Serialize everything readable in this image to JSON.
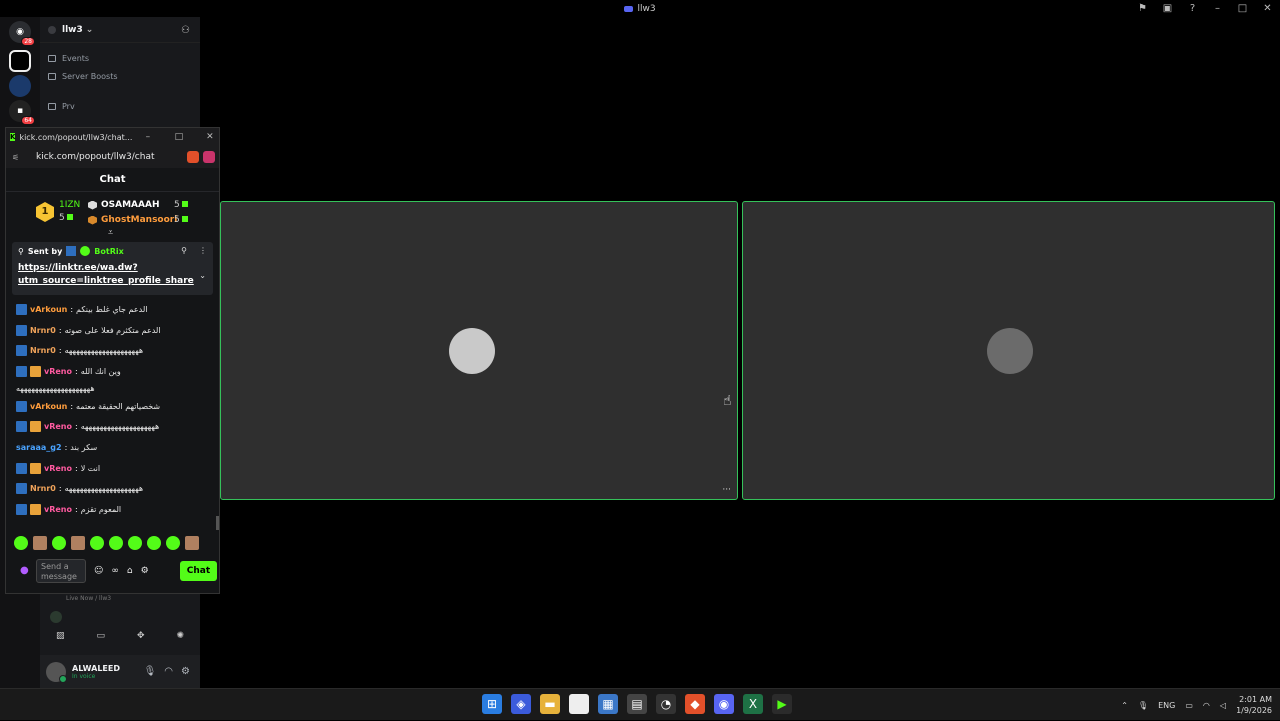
{
  "window": {
    "title": "llw3",
    "buttons": [
      "pin-icon",
      "inbox-icon",
      "help-icon"
    ]
  },
  "guilds": {
    "top_badge": "28",
    "mid_badge": "64",
    "srv_label": "llw3"
  },
  "server": {
    "name": "llw3",
    "channels": [
      {
        "label": "Events",
        "icon": "calendar-icon"
      },
      {
        "label": "Server Boosts",
        "icon": "boost-icon"
      },
      {
        "label": "Prv",
        "icon": "speaker-icon"
      }
    ],
    "voice_status": "Live Now / llw3"
  },
  "user": {
    "name": "ALWALEED",
    "status": "In voice"
  },
  "popout": {
    "title": "kick.com/popout/llw3/chat...",
    "url": "kick.com/popout/llw3/chat",
    "chat_title": "Chat",
    "leaderboard": {
      "first": {
        "rank": "1",
        "name": "1IZN",
        "count": "5"
      },
      "others": [
        {
          "name": "OSAMAAAH",
          "count": "5"
        },
        {
          "name": "GhostMansoori",
          "count": "5"
        }
      ]
    },
    "pinned": {
      "sent_by_label": "Sent by",
      "bot_name": "BotRix",
      "link_line1": "https://linktr.ee/wa.dw?",
      "link_line2": "utm_source=linktree_profile_share"
    },
    "messages": [
      {
        "user": "vArkoun",
        "color": "#ff9d3d",
        "text": "الدعم جاي غلط بينكم",
        "crown": false,
        "badge": true
      },
      {
        "user": "Nrnr0",
        "color": "#f0a35a",
        "text": "الدعم متكثرم فعلا على صوته",
        "crown": false,
        "badge": true
      },
      {
        "user": "Nrnr0",
        "color": "#f0a35a",
        "text": "ههههههههههههههههههههه",
        "crown": false,
        "badge": true
      },
      {
        "user": "vReno",
        "color": "#ff5aa0",
        "text": "وين انك الله",
        "crown": true,
        "badge": true
      },
      {
        "user": "",
        "color": "#ffffff",
        "text": "ههههههههههههههههههههه",
        "crown": false,
        "badge": false
      },
      {
        "user": "vArkoun",
        "color": "#ff9d3d",
        "text": "شخصياتهم الحقيقة معتمه",
        "crown": false,
        "badge": true
      },
      {
        "user": "vReno",
        "color": "#ff5aa0",
        "text": "ههههههههههههههههههههه",
        "crown": true,
        "badge": true
      },
      {
        "user": "saraaa_g2",
        "color": "#4aa3ff",
        "text": "سكر بند",
        "crown": false,
        "badge": false
      },
      {
        "user": "vReno",
        "color": "#ff5aa0",
        "text": "انت لا",
        "crown": true,
        "badge": true
      },
      {
        "user": "Nrnr0",
        "color": "#f0a35a",
        "text": "ههههههههههههههههههههه",
        "crown": false,
        "badge": true
      },
      {
        "user": "vReno",
        "color": "#ff5aa0",
        "text": "المعوم تقزم",
        "crown": true,
        "badge": true
      }
    ],
    "composer": {
      "placeholder": "Send a message",
      "send_label": "Chat"
    }
  },
  "stage": {
    "more_label": "···"
  },
  "taskbar": {
    "lang": "ENG",
    "time": "2:01 AM",
    "date": "1/9/2026"
  },
  "colors": {
    "kick_green": "#53fc18",
    "speaking_border": "#35c15a"
  }
}
